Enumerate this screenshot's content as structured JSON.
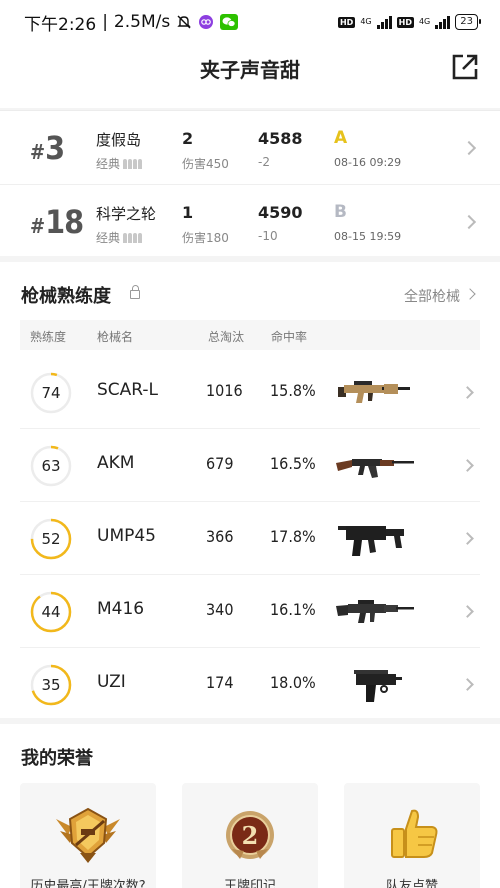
{
  "status_bar": {
    "time": "下午2:26",
    "speed": "2.5M/s",
    "network_1": "4G",
    "network_2": "4G",
    "battery": "23"
  },
  "header": {
    "title": "夹子声音甜"
  },
  "matches": [
    {
      "rank_hash": "#",
      "rank": "3",
      "map": "度假岛",
      "mode": "经典",
      "kills": "2",
      "damage": "伤害450",
      "rating": "4588",
      "rating_delta": "-2",
      "grade": "A",
      "grade_color": "#e6c21c",
      "date": "08-16 09:29"
    },
    {
      "rank_hash": "#",
      "rank": "18",
      "map": "科学之轮",
      "mode": "经典",
      "kills": "1",
      "damage": "伤害180",
      "rating": "4590",
      "rating_delta": "-10",
      "grade": "B",
      "grade_color": "#b5b9c3",
      "date": "08-15 19:59"
    }
  ],
  "weapons": {
    "title": "枪械熟练度",
    "view_all": "全部枪械",
    "columns": {
      "proficiency": "熟练度",
      "name": "枪械名",
      "kills": "总淘汰",
      "accuracy": "命中率"
    },
    "ring_color": "#f2b81b",
    "rows": [
      {
        "proficiency": "74",
        "proficiency_ring_fraction": 0.05,
        "name": "SCAR-L",
        "kills": "1016",
        "accuracy": "15.8%",
        "icon": "scar-l-rifle-icon"
      },
      {
        "proficiency": "63",
        "proficiency_ring_fraction": 0.06,
        "name": "AKM",
        "kills": "679",
        "accuracy": "16.5%",
        "icon": "akm-rifle-icon"
      },
      {
        "proficiency": "52",
        "proficiency_ring_fraction": 0.75,
        "name": "UMP45",
        "kills": "366",
        "accuracy": "17.8%",
        "icon": "ump45-smg-icon"
      },
      {
        "proficiency": "44",
        "proficiency_ring_fraction": 0.9,
        "name": "M416",
        "kills": "340",
        "accuracy": "16.1%",
        "icon": "m416-rifle-icon"
      },
      {
        "proficiency": "35",
        "proficiency_ring_fraction": 0.7,
        "name": "UZI",
        "kills": "174",
        "accuracy": "18.0%",
        "icon": "uzi-smg-icon"
      }
    ]
  },
  "honors": {
    "title": "我的荣誉",
    "cards": [
      {
        "label": "历史最高/王牌次数?",
        "icon": "ace-badge-icon"
      },
      {
        "label": "王牌印记",
        "badge_number": "2",
        "icon": "ace-mark-medal-icon"
      },
      {
        "label": "队友点赞",
        "icon": "thumbs-up-icon"
      }
    ]
  }
}
